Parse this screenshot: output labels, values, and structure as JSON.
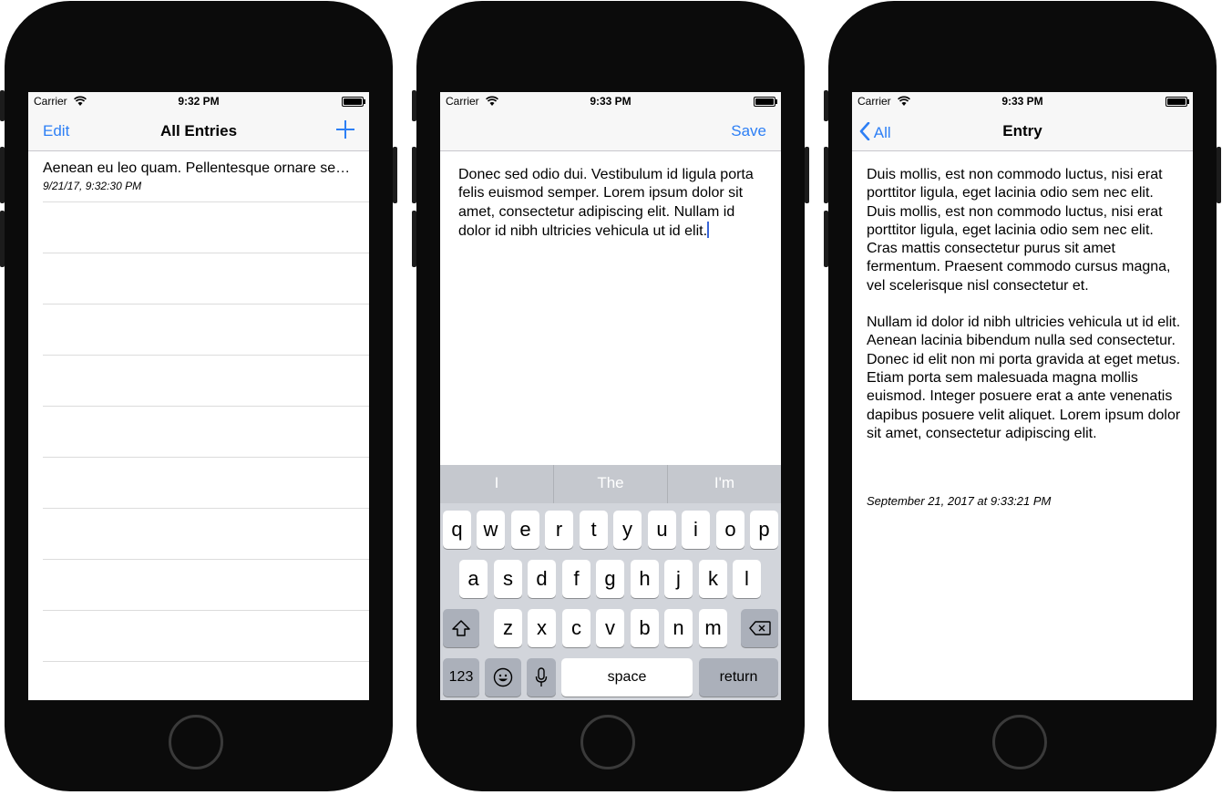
{
  "phone1": {
    "status": {
      "carrier": "Carrier",
      "time": "9:32 PM"
    },
    "nav": {
      "left": "Edit",
      "title": "All Entries",
      "right_icon": "plus-icon"
    },
    "entries": [
      {
        "title": "Aenean eu leo quam. Pellentesque ornare sem lacinia quam venenatis vestibulum.",
        "date": "9/21/17, 9:32:30 PM"
      }
    ]
  },
  "phone2": {
    "status": {
      "carrier": "Carrier",
      "time": "9:33 PM"
    },
    "nav": {
      "right": "Save"
    },
    "text": "Donec sed odio dui. Vestibulum id ligula porta felis euismod semper. Lorem ipsum dolor sit amet, consectetur adipiscing elit. Nullam id dolor id nibh ultricies vehicula ut id elit.",
    "keyboard": {
      "suggestions": [
        "I",
        "The",
        "I'm"
      ],
      "row1": [
        "q",
        "w",
        "e",
        "r",
        "t",
        "y",
        "u",
        "i",
        "o",
        "p"
      ],
      "row2": [
        "a",
        "s",
        "d",
        "f",
        "g",
        "h",
        "j",
        "k",
        "l"
      ],
      "row3": [
        "z",
        "x",
        "c",
        "v",
        "b",
        "n",
        "m"
      ],
      "numbers": "123",
      "space": "space",
      "return": "return"
    }
  },
  "phone3": {
    "status": {
      "carrier": "Carrier",
      "time": "9:33 PM"
    },
    "nav": {
      "back": "All",
      "title": "Entry"
    },
    "paragraphs": [
      "Duis mollis, est non commodo luctus, nisi erat porttitor ligula, eget lacinia odio sem nec elit. Duis mollis, est non commodo luctus, nisi erat porttitor ligula, eget lacinia odio sem nec elit. Cras mattis consectetur purus sit amet fermentum. Praesent commodo cursus magna, vel scelerisque nisl consectetur et.",
      "Nullam id dolor id nibh ultricies vehicula ut id elit. Aenean lacinia bibendum nulla sed consectetur. Donec id elit non mi porta gravida at eget metus. Etiam porta sem malesuada magna mollis euismod. Integer posuere erat a ante venenatis dapibus posuere velit aliquet. Lorem ipsum dolor sit amet, consectetur adipiscing elit."
    ],
    "date": "September 21, 2017 at 9:33:21 PM"
  },
  "colors": {
    "accent": "#2d7ff5",
    "phone_body": "#0b0b0b",
    "keyboard_bg": "#d2d5db"
  }
}
